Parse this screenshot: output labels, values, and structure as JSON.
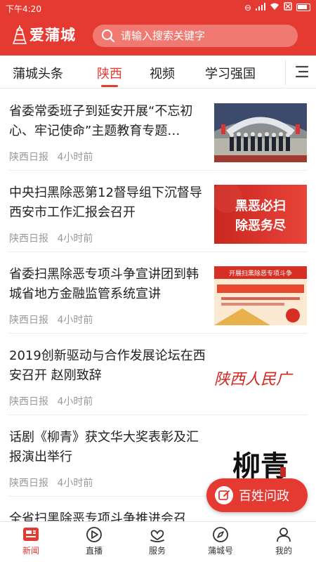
{
  "status_bar": {
    "time": "下午4:20",
    "icons": [
      "dnd-icon",
      "signal-icon",
      "wifi-icon",
      "sim-off-icon",
      "battery-icon"
    ]
  },
  "header": {
    "logo_text": "爱蒲城",
    "search_placeholder": "请输入搜索关键字"
  },
  "tabs": [
    {
      "label": "蒲城头条",
      "active": false
    },
    {
      "label": "陕西",
      "active": true
    },
    {
      "label": "视频",
      "active": false
    },
    {
      "label": "学习强国",
      "active": false
    }
  ],
  "news": [
    {
      "title": "省委常委班子到延安开展“不忘初心、牢记使命”主题教育专题…",
      "source": "陕西日报",
      "time": "4小时前",
      "thumb": "group-photo"
    },
    {
      "title": "中央扫黑除恶第12督导组下沉督导西安市工作汇报会召开",
      "source": "陕西日报",
      "time": "4小时前",
      "thumb": "calligraphy-banner",
      "thumb_text": "黑恶必扫 除恶务尽"
    },
    {
      "title": "省委扫黑除恶专项斗争宣讲团到韩城省地方金融监管系统宣讲",
      "source": "陕西日报",
      "time": "4小时前",
      "thumb": "campaign-poster",
      "thumb_text": "开展扫黑除恶专项斗争"
    },
    {
      "title": "2019创新驱动与合作发展论坛在西安召开 赵刚致辞",
      "source": "陕西日报",
      "time": "4小时前",
      "thumb": "newspaper-logo",
      "thumb_text": "陕西人民广"
    },
    {
      "title": "话剧《柳青》获文华大奖表彰及汇报演出举行",
      "source": "陕西日报",
      "time": "4小时前",
      "thumb": "calligraphy-title",
      "thumb_text": "柳青"
    },
    {
      "title": "全省扫黑除恶专项斗争推进会召",
      "source": "",
      "time": "",
      "thumb": ""
    }
  ],
  "fab": {
    "label": "百姓问政"
  },
  "bottom_nav": [
    {
      "label": "新闻",
      "icon": "news-icon",
      "active": true
    },
    {
      "label": "直播",
      "icon": "live-icon",
      "active": false
    },
    {
      "label": "服务",
      "icon": "service-icon",
      "active": false
    },
    {
      "label": "蒲城号",
      "icon": "compass-icon",
      "active": false
    },
    {
      "label": "我的",
      "icon": "user-icon",
      "active": false
    }
  ],
  "colors": {
    "brand_red": "#e53a32",
    "meta_gray": "#999999",
    "text": "#222222"
  }
}
